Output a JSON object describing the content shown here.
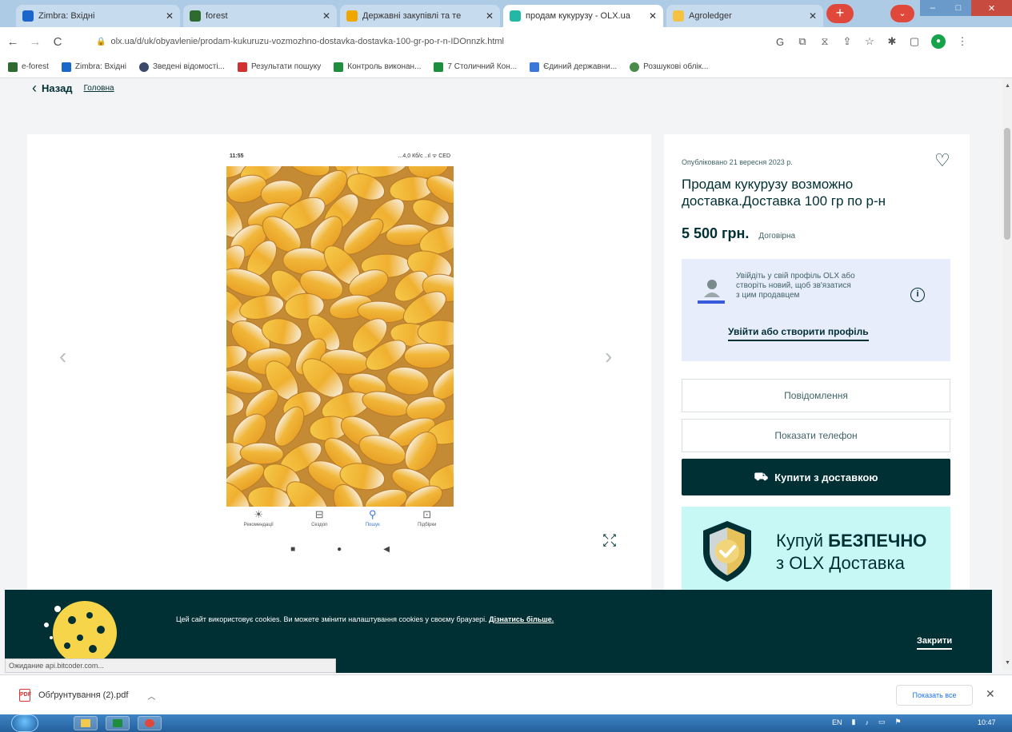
{
  "tabs": [
    {
      "label": "Zimbra: Вхідні",
      "color": "#1b66c9",
      "active": false
    },
    {
      "label": "forest",
      "color": "#2f6b2f",
      "active": false
    },
    {
      "label": "Державні закупівлі та те",
      "color": "#f0a800",
      "active": false
    },
    {
      "label": "продам кукурузу - OLX.ua",
      "color": "#23b7a5",
      "active": true
    },
    {
      "label": "Agroledger",
      "color": "#f5c242",
      "active": false
    }
  ],
  "address": {
    "url": "olx.ua/d/uk/obyavlenie/prodam-kukuruzu-vozmozhno-dostavka-dostavka-100-gr-po-r-n-IDOnnzk.html"
  },
  "bookmarks": [
    {
      "label": "e-forest",
      "color": "#2f6b2f"
    },
    {
      "label": "Zimbra: Вхідні",
      "color": "#1b66c9"
    },
    {
      "label": "Зведені відомості...",
      "color": "#3b4a6b"
    },
    {
      "label": "Результати пошуку",
      "color": "#d33030"
    },
    {
      "label": "Контроль виконан...",
      "color": "#1e8e3e"
    },
    {
      "label": "7 Столичний Кон...",
      "color": "#1e8e3e"
    },
    {
      "label": "Єдиний державни...",
      "color": "#3a77d9"
    },
    {
      "label": "Розшукові облік...",
      "color": "#4a8a4a"
    }
  ],
  "page": {
    "back_label": "Назад",
    "breadcrumb": "Головна"
  },
  "gallery": {
    "phone_time": "11:55",
    "phone_signal": "...4,0 Кб/с ..ıl ᯤ CED",
    "nav_items": [
      {
        "icon": "☀",
        "label": "Рекомендації",
        "selected": false
      },
      {
        "icon": "⊟",
        "label": "Сездоn",
        "selected": false
      },
      {
        "icon": "⚲",
        "label": "Пошук",
        "selected": true
      },
      {
        "icon": "⊡",
        "label": "Підбірки",
        "selected": false
      }
    ]
  },
  "listing": {
    "published": "Опубліковано 21 вересня 2023 р.",
    "title": "Продам кукурузу возможно доставка.Доставка 100 гр по р-н",
    "price": "5 500 грн.",
    "negotiable": "Договірна",
    "login_prompt": "Увійдіть у свій профіль OLX або створіть новий, щоб зв'язатися з цим продавцем",
    "login_link": "Увійти або створити профіль",
    "message_button": "Повідомлення",
    "phone_button": "Показати телефон",
    "buy_button": "Купити з доставкою",
    "promo_line1_a": "Купуй ",
    "promo_line1_b": "БЕЗПЕЧНО",
    "promo_line2": "з OLX Доставка"
  },
  "cookie": {
    "text": "Цей сайт використовує cookies. Ви можете змінити налаштування cookies у своєму браузері. ",
    "more_link": "Дізнатись більше.",
    "close": "Закрити"
  },
  "status_bar": "Ожидание api.bitcoder.com...",
  "downloads": {
    "file": "Обґрунтування (2).pdf",
    "show_all": "Показать все"
  },
  "taskbar": {
    "lang": "EN",
    "time": "10:47"
  },
  "colors": {
    "olx_dark": "#002f34",
    "login_box": "#e8edfc",
    "promo_bg": "#c8f8f6",
    "corn": "#e8a93a"
  }
}
